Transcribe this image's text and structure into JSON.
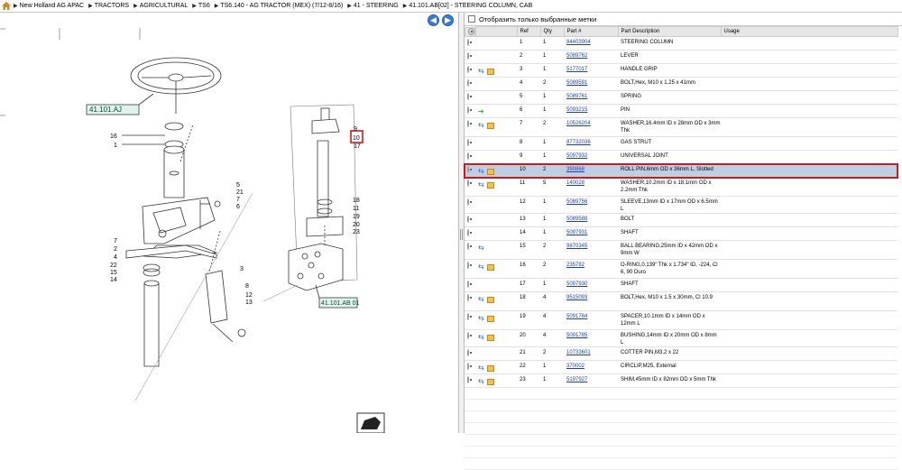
{
  "breadcrumb": [
    {
      "label": "New Holland AG APAC"
    },
    {
      "label": "TRACTORS"
    },
    {
      "label": "AGRICULTURAL"
    },
    {
      "label": "TS6"
    },
    {
      "label": "TS6.140 - AG TRACTOR (MEX) (7/12-8/16)"
    },
    {
      "label": "41 - STEERING"
    },
    {
      "label": "41.101.AB[02] - STEERING COLUMN, CAB"
    }
  ],
  "diagram": {
    "callouts": {
      "ref_left_top": "41.101.AJ",
      "ref_right_bottom": "41.101.AB 01",
      "highlight_label": "10"
    },
    "labels": [
      "16",
      "1",
      "5",
      "21",
      "7",
      "6",
      "7",
      "2",
      "4",
      "22",
      "15",
      "14",
      "3",
      "8",
      "12",
      "13",
      "9",
      "17",
      "18",
      "11",
      "19",
      "20",
      "23"
    ]
  },
  "filter": {
    "label": "Отобразить только выбранные метки"
  },
  "table": {
    "headers": {
      "ref": "Ref",
      "qty": "Qty",
      "part": "Part #",
      "desc": "Part Description",
      "usage": "Usage"
    },
    "rows": [
      {
        "ref": "1",
        "qty": "1",
        "part": "84403904",
        "desc": "STEERING COLUMN",
        "icons": []
      },
      {
        "ref": "2",
        "qty": "1",
        "part": "5089762",
        "desc": "LEVER",
        "icons": []
      },
      {
        "ref": "3",
        "qty": "1",
        "part": "5177017",
        "desc": "HANDLE GRIP",
        "icons": [
          "swap",
          "box"
        ]
      },
      {
        "ref": "4",
        "qty": "2",
        "part": "5089591",
        "desc": "BOLT,Hex, M10 x 1.25 x 41mm",
        "icons": []
      },
      {
        "ref": "5",
        "qty": "1",
        "part": "5089761",
        "desc": "SPRING",
        "icons": []
      },
      {
        "ref": "6",
        "qty": "1",
        "part": "5093215",
        "desc": "PIN",
        "icons": [
          "arrow"
        ]
      },
      {
        "ref": "7",
        "qty": "2",
        "part": "10526204",
        "desc": "WASHER,16.4mm ID x 28mm OD x 3mm Thk",
        "icons": [
          "swap",
          "box"
        ]
      },
      {
        "ref": "8",
        "qty": "1",
        "part": "87732036",
        "desc": "GAS STRUT",
        "icons": []
      },
      {
        "ref": "9",
        "qty": "1",
        "part": "5097932",
        "desc": "UNIVERSAL JOINT",
        "icons": []
      },
      {
        "ref": "10",
        "qty": "2",
        "part": "390868",
        "desc": "ROLL PIN,6mm OD x 36mm L, Slotted",
        "icons": [
          "swap",
          "box"
        ],
        "selected": true
      },
      {
        "ref": "11",
        "qty": "5",
        "part": "140028",
        "desc": "WASHER,10.2mm ID x 18.1mm OD x 2.2mm Thk",
        "icons": [
          "swap",
          "box"
        ]
      },
      {
        "ref": "12",
        "qty": "1",
        "part": "5089756",
        "desc": "SLEEVE,13mm ID x 17mm OD x 6.5mm L",
        "icons": []
      },
      {
        "ref": "13",
        "qty": "1",
        "part": "5089588",
        "desc": "BOLT",
        "icons": []
      },
      {
        "ref": "14",
        "qty": "1",
        "part": "5097931",
        "desc": "SHAFT",
        "icons": []
      },
      {
        "ref": "15",
        "qty": "2",
        "part": "9870345",
        "desc": "BALL BEARING,25mm ID x 42mm OD x 9mm W",
        "icons": [
          "swap"
        ]
      },
      {
        "ref": "16",
        "qty": "2",
        "part": "235782",
        "desc": "O-RING,0.139\" Thk x 1.734\" ID, -224, Cl 6, 90 Duro",
        "icons": [
          "swap",
          "box"
        ]
      },
      {
        "ref": "17",
        "qty": "1",
        "part": "5097930",
        "desc": "SHAFT",
        "icons": []
      },
      {
        "ref": "18",
        "qty": "4",
        "part": "9515093",
        "desc": "BOLT,Hex, M10 x 1.5 x 30mm, Cl 10.9",
        "icons": [
          "swap",
          "box"
        ]
      },
      {
        "ref": "19",
        "qty": "4",
        "part": "5091784",
        "desc": "SPACER,10.1mm ID x 14mm OD x 12mm L",
        "icons": [
          "swap",
          "box"
        ]
      },
      {
        "ref": "20",
        "qty": "4",
        "part": "5091785",
        "desc": "BUSHING,14mm ID x 20mm OD x 8mm L",
        "icons": [
          "swap",
          "box"
        ]
      },
      {
        "ref": "21",
        "qty": "2",
        "part": "10733601",
        "desc": "COTTER PIN,M3.2 x 22",
        "icons": []
      },
      {
        "ref": "22",
        "qty": "1",
        "part": "370002",
        "desc": "CIRCLIP,M25, External",
        "icons": [
          "swap",
          "box"
        ]
      },
      {
        "ref": "23",
        "qty": "1",
        "part": "5197927",
        "desc": "SHIM,45mm ID x 82mm OD x 5mm Thk",
        "icons": [
          "swap",
          "box"
        ]
      }
    ]
  }
}
